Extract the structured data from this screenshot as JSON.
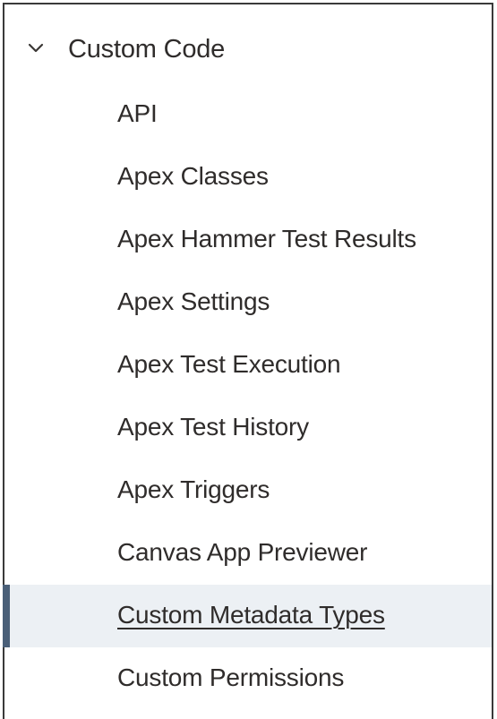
{
  "section": {
    "title": "Custom Code",
    "icon": "chevron-down-icon"
  },
  "items": [
    {
      "label": "API"
    },
    {
      "label": "Apex Classes"
    },
    {
      "label": "Apex Hammer Test Results"
    },
    {
      "label": "Apex Settings"
    },
    {
      "label": "Apex Test Execution"
    },
    {
      "label": "Apex Test History"
    },
    {
      "label": "Apex Triggers"
    },
    {
      "label": "Canvas App Previewer"
    },
    {
      "label": "Custom Metadata Types",
      "selected": true
    },
    {
      "label": "Custom Permissions"
    }
  ],
  "colors": {
    "selected_background": "#ecf0f4",
    "selected_indicator": "#4a5f78",
    "text": "#2f2c2b",
    "border": "#3a3a3a"
  }
}
